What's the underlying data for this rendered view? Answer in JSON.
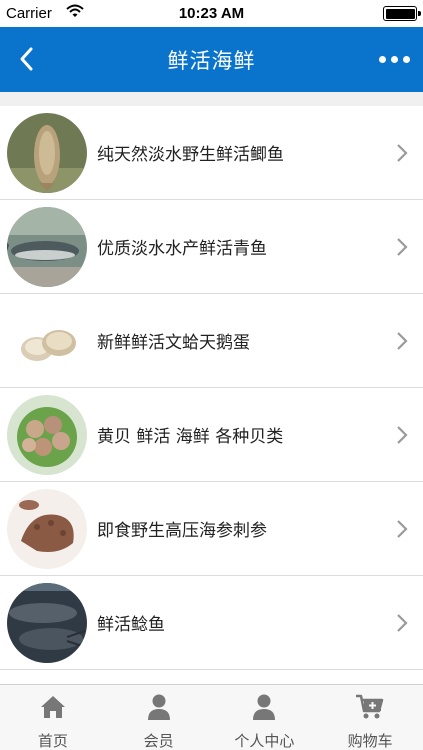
{
  "status_bar": {
    "carrier": "Carrier",
    "time": "10:23 AM"
  },
  "header": {
    "title": "鲜活海鲜"
  },
  "list": [
    {
      "label": "纯天然淡水野生鲜活鲫鱼",
      "thumb": "crucian-carp-image"
    },
    {
      "label": "优质淡水水产鲜活青鱼",
      "thumb": "black-carp-image"
    },
    {
      "label": "新鲜鲜活文蛤天鹅蛋",
      "thumb": "clam-image"
    },
    {
      "label": "黄贝 鲜活 海鲜 各种贝类",
      "thumb": "shellfish-platter-image"
    },
    {
      "label": "即食野生高压海参刺参",
      "thumb": "sea-cucumber-image"
    },
    {
      "label": "鲜活鲶鱼",
      "thumb": "catfish-image"
    }
  ],
  "tabs": [
    {
      "label": "首页",
      "icon": "home-icon"
    },
    {
      "label": "会员",
      "icon": "member-icon"
    },
    {
      "label": "个人中心",
      "icon": "user-center-icon"
    },
    {
      "label": "购物车",
      "icon": "cart-icon"
    }
  ],
  "colors": {
    "primary": "#0a74cc",
    "tab_icon": "#777777"
  }
}
